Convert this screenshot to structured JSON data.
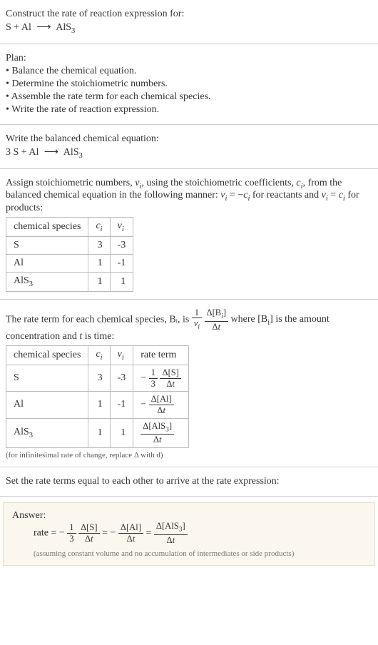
{
  "header": {
    "prompt": "Construct the rate of reaction expression for:",
    "equation": "S + Al ⟶ AlS₃"
  },
  "plan": {
    "title": "Plan:",
    "items": [
      "Balance the chemical equation.",
      "Determine the stoichiometric numbers.",
      "Assemble the rate term for each chemical species.",
      "Write the rate of reaction expression."
    ]
  },
  "balanced": {
    "title": "Write the balanced chemical equation:",
    "equation": "3 S + Al ⟶ AlS₃"
  },
  "stoich": {
    "intro_1": "Assign stoichiometric numbers, νᵢ, using the stoichiometric coefficients, cᵢ, from the balanced chemical equation in the following manner: νᵢ = −cᵢ for reactants and νᵢ = cᵢ for products:",
    "headers": {
      "species": "chemical species",
      "c": "cᵢ",
      "v": "νᵢ"
    },
    "rows": [
      {
        "sp": "S",
        "c": "3",
        "v": "-3"
      },
      {
        "sp": "Al",
        "c": "1",
        "v": "-1"
      },
      {
        "sp": "AlS₃",
        "c": "1",
        "v": "1"
      }
    ]
  },
  "rateterm": {
    "intro_pre": "The rate term for each chemical species, Bᵢ, is ",
    "intro_post": " where [Bᵢ] is the amount concentration and t is time:",
    "headers": {
      "species": "chemical species",
      "c": "cᵢ",
      "v": "νᵢ",
      "rt": "rate term"
    },
    "rows": [
      {
        "sp": "S",
        "c": "3",
        "v": "-3",
        "sign": "−",
        "coef_num": "1",
        "coef_den": "3",
        "delta": "Δ[S]",
        "dt": "Δt"
      },
      {
        "sp": "Al",
        "c": "1",
        "v": "-1",
        "sign": "−",
        "coef_num": "",
        "coef_den": "",
        "delta": "Δ[Al]",
        "dt": "Δt"
      },
      {
        "sp": "AlS₃",
        "c": "1",
        "v": "1",
        "sign": "",
        "coef_num": "",
        "coef_den": "",
        "delta": "Δ[AlS₃]",
        "dt": "Δt"
      }
    ],
    "generic": {
      "coef_num": "1",
      "coef_den": "νᵢ",
      "delta": "Δ[Bᵢ]",
      "dt": "Δt"
    },
    "footnote": "(for infinitesimal rate of change, replace Δ with d)"
  },
  "final": {
    "title": "Set the rate terms equal to each other to arrive at the rate expression:"
  },
  "answer": {
    "label": "Answer:",
    "prefix": "rate = ",
    "terms": [
      {
        "sign": "−",
        "coef_num": "1",
        "coef_den": "3",
        "delta": "Δ[S]",
        "dt": "Δt"
      },
      {
        "sign": "−",
        "coef_num": "",
        "coef_den": "",
        "delta": "Δ[Al]",
        "dt": "Δt"
      },
      {
        "sign": "",
        "coef_num": "",
        "coef_den": "",
        "delta": "Δ[AlS₃]",
        "dt": "Δt"
      }
    ],
    "note": "(assuming constant volume and no accumulation of intermediates or side products)"
  },
  "chart_data": {
    "type": "table",
    "title": "Stoichiometric numbers and rate terms for S + Al → AlS₃",
    "balanced_equation": "3 S + Al → AlS₃",
    "species": [
      {
        "name": "S",
        "c_i": 3,
        "nu_i": -3,
        "rate_term": "-(1/3) Δ[S]/Δt"
      },
      {
        "name": "Al",
        "c_i": 1,
        "nu_i": -1,
        "rate_term": "- Δ[Al]/Δt"
      },
      {
        "name": "AlS3",
        "c_i": 1,
        "nu_i": 1,
        "rate_term": "Δ[AlS₃]/Δt"
      }
    ],
    "rate_expression": "rate = -(1/3) Δ[S]/Δt = - Δ[Al]/Δt = Δ[AlS₃]/Δt"
  }
}
